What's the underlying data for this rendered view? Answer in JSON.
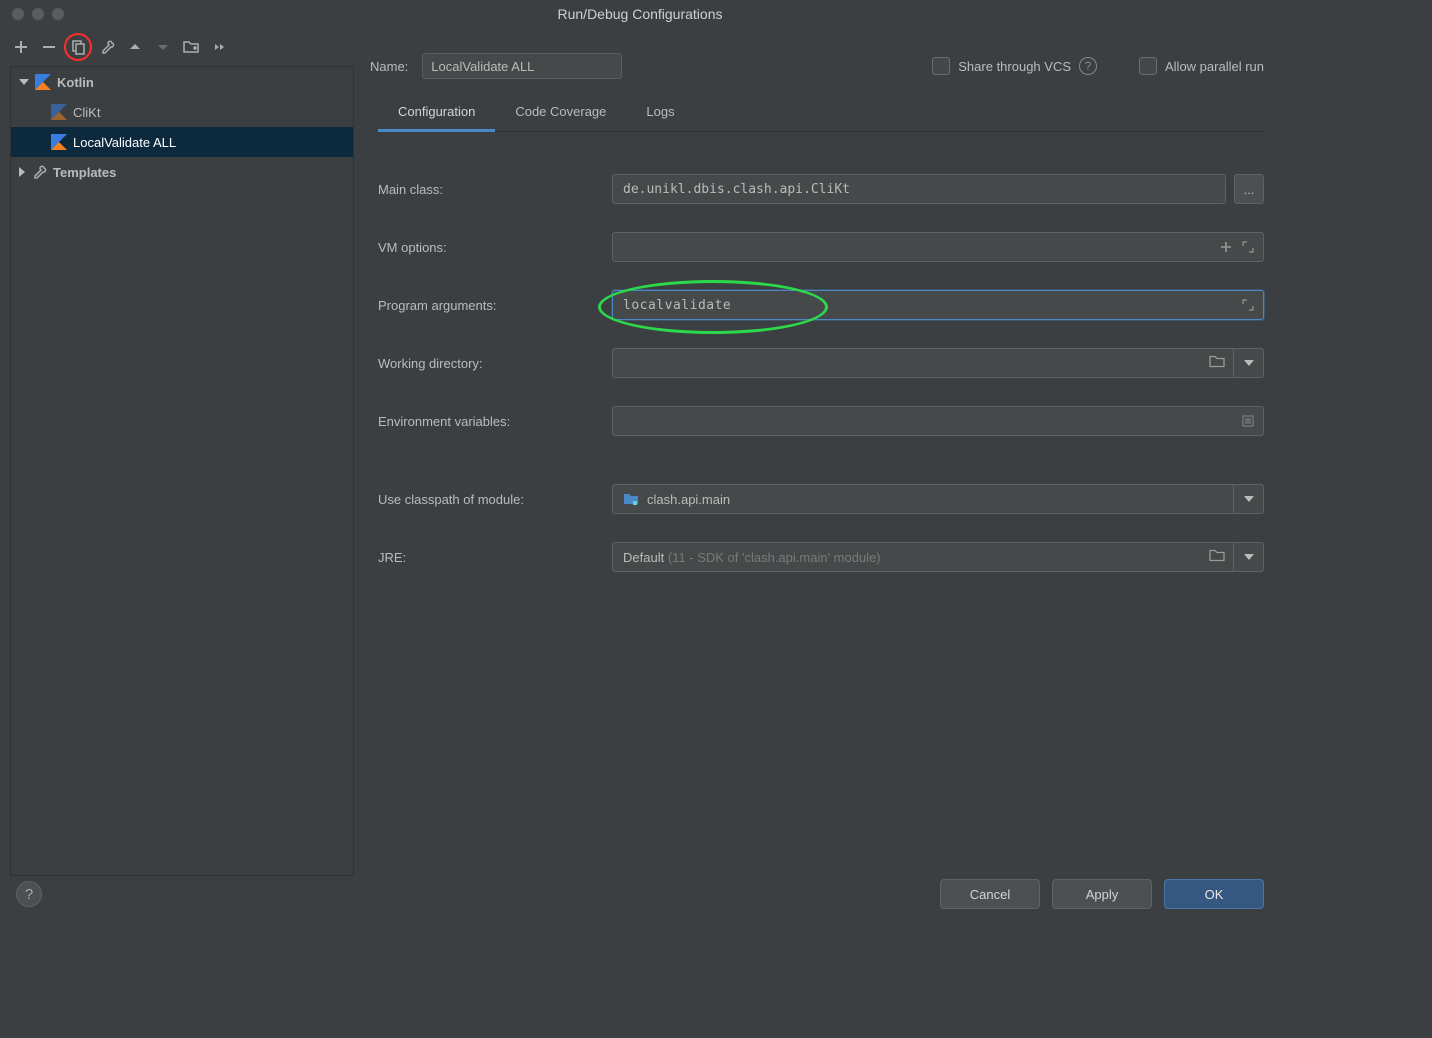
{
  "dialog_title": "Run/Debug Configurations",
  "name_label": "Name:",
  "name_value": "LocalValidate ALL",
  "share_label": "Share through VCS",
  "allow_parallel_label": "Allow parallel run",
  "tree": {
    "root": "Kotlin",
    "items": [
      "CliKt",
      "LocalValidate ALL"
    ],
    "templates": "Templates"
  },
  "tabs": [
    "Configuration",
    "Code Coverage",
    "Logs"
  ],
  "config": {
    "main_class_label": "Main class:",
    "main_class_value": "de.unikl.dbis.clash.api.CliKt",
    "vm_options_label": "VM options:",
    "vm_options_value": "",
    "program_args_label": "Program arguments:",
    "program_args_value": "localvalidate",
    "working_dir_label": "Working directory:",
    "working_dir_value": "",
    "env_vars_label": "Environment variables:",
    "env_vars_value": "",
    "classpath_label": "Use classpath of module:",
    "classpath_value": "clash.api.main",
    "jre_label": "JRE:",
    "jre_value": "Default",
    "jre_hint": " (11 - SDK of 'clash.api.main' module)"
  },
  "browse_btn": "...",
  "buttons": {
    "cancel": "Cancel",
    "apply": "Apply",
    "ok": "OK"
  }
}
